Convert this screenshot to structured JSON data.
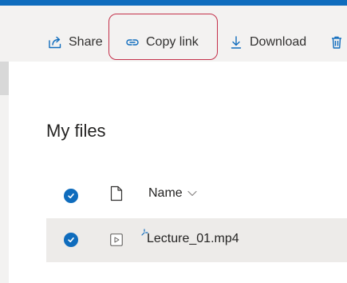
{
  "toolbar": {
    "share_label": "Share",
    "copy_link_label": "Copy link",
    "download_label": "Download",
    "delete_label": ""
  },
  "page": {
    "title": "My files"
  },
  "file_list": {
    "name_column_header": "Name",
    "rows": [
      {
        "name": "Lecture_01.mp4",
        "type_icon": "video-file-icon",
        "selected": true,
        "new_indicator": true
      }
    ]
  },
  "colors": {
    "accent": "#0f6cbd",
    "highlight_outline": "#c4314b",
    "toolbar_bg": "#f3f2f1",
    "selected_row_bg": "#edebe9"
  },
  "icons": {
    "share": "share-icon",
    "copy_link": "link-icon",
    "download": "download-icon",
    "delete": "trash-icon",
    "file_header": "file-icon",
    "sort": "chevron-down-icon",
    "check": "checkmark-icon"
  }
}
